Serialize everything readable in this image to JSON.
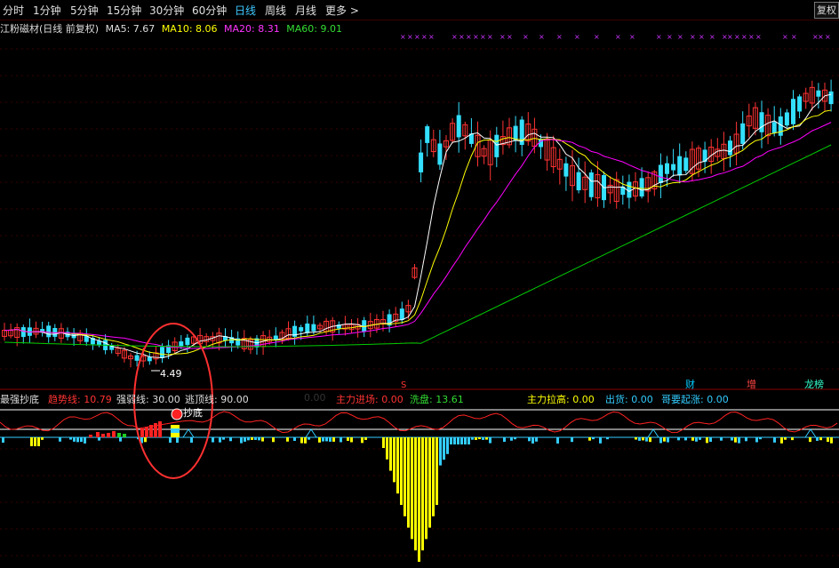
{
  "toolbar": {
    "tabs": [
      "分时",
      "1分钟",
      "5分钟",
      "15分钟",
      "30分钟",
      "60分钟",
      "日线",
      "周线",
      "月线",
      "更多"
    ],
    "active_tab": "日线",
    "more_arrow": ">",
    "right_button": "复权"
  },
  "chart_info": {
    "stock_name": "江粉磁材(日线 前复权)",
    "ma5_label": "MA5: 7.67",
    "ma10_label": "MA10: 8.06",
    "ma20_label": "MA20: 8.31",
    "ma60_label": "MA60: 9.01",
    "colors": {
      "ma5": "#ffffff",
      "ma10": "#ffff00",
      "ma20": "#ff00ff",
      "ma60": "#00cc00"
    }
  },
  "annotations": {
    "low_price": "4.49",
    "marker_s": "S",
    "signal_cai": "财",
    "signal_zeng": "增",
    "signal_bang": "龙榜",
    "chaodi_label": "抄底"
  },
  "indicator": {
    "name": "最强抄底",
    "trend_line": "趋势线: 10.79",
    "strong_weak": "强弱线: 30.00",
    "escape_top": "逃顶线: 90.00",
    "hidden_val": "0.00",
    "main_entry": "主力进场: 0.00",
    "wash": "洗盘: 13.61",
    "main_raise": "主力拉高: 0.00",
    "ship": "出货: 0.00",
    "brother": "哥要起涨: 0.00"
  },
  "chart_data": {
    "type": "candlestick",
    "indicators": [
      "MA5",
      "MA10",
      "MA20",
      "MA60"
    ],
    "ma_latest": {
      "MA5": 7.67,
      "MA10": 8.06,
      "MA20": 8.31,
      "MA60": 9.01
    },
    "lowest_marked_price": 4.49
  }
}
